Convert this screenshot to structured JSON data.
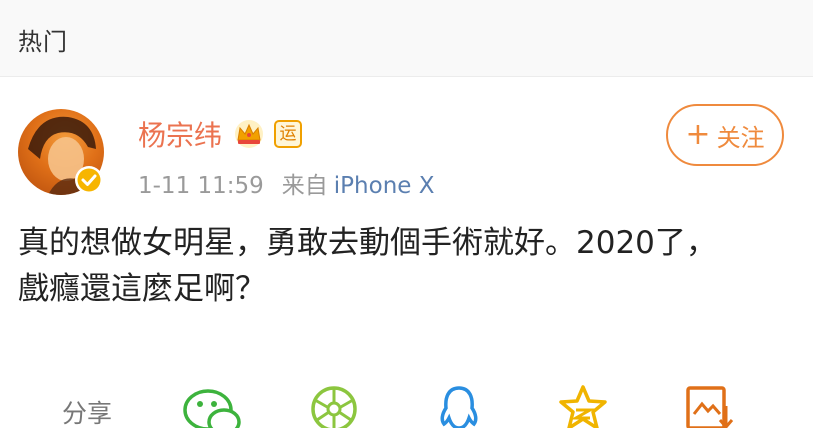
{
  "header": {
    "title": "热门"
  },
  "post": {
    "author_name": "杨宗纬",
    "badges": {
      "crown_icon": "crown-icon",
      "yun_label": "运"
    },
    "time": "1-11 11:59",
    "source_prefix": "来自",
    "device": "iPhone X",
    "content_lines": [
      "真的想做女明星，勇敢去動個手術就好。2020了，",
      "戲癮還這麼足啊？"
    ]
  },
  "follow_button": {
    "plus": "+",
    "label": "关注"
  },
  "share": {
    "label": "分享",
    "icons": [
      "wechat-icon",
      "moments-icon",
      "qq-icon",
      "qzone-icon",
      "save-image-icon"
    ]
  },
  "colors": {
    "accent": "#eb7350",
    "follow_border": "#ef8a3d",
    "link": "#5b7fb0",
    "green": "#3db33d",
    "blue": "#2a8ee0",
    "gold": "#f0b400"
  }
}
